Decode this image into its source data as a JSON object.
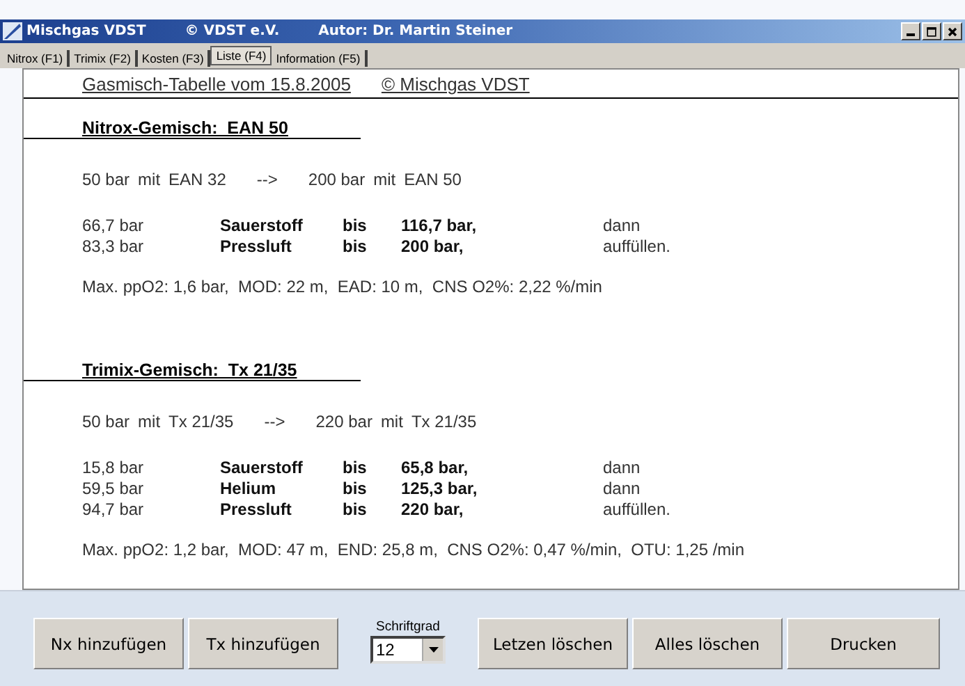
{
  "window": {
    "title_parts": [
      "Mischgas VDST",
      "© VDST e.V.",
      "Autor: Dr. Martin Steiner"
    ]
  },
  "tabs": [
    {
      "label": "Nitrox (F1)",
      "selected": false
    },
    {
      "label": "Trimix (F2)",
      "selected": false
    },
    {
      "label": "Kosten (F3)",
      "selected": false
    },
    {
      "label": "Liste (F4)",
      "selected": true
    },
    {
      "label": "Information (F5)",
      "selected": false
    }
  ],
  "document": {
    "header": [
      "Gasmisch-Tabelle vom 15.8.2005",
      "© Mischgas VDST"
    ],
    "sections": [
      {
        "heading": "Nitrox-Gemisch:  EAN 50",
        "summary": [
          "50 bar",
          "mit",
          "EAN 32",
          "-->",
          "200 bar",
          "mit",
          "EAN 50"
        ],
        "rows": [
          {
            "amount": "66,7 bar",
            "gas": "Sauerstoff",
            "bis": "bis",
            "target": "116,7 bar,",
            "action": "dann"
          },
          {
            "amount": "83,3 bar",
            "gas": "Pressluft",
            "bis": "bis",
            "target": "200 bar,",
            "action": "auffüllen."
          }
        ],
        "info": "Max. ppO2: 1,6 bar,  MOD: 22 m,  EAD: 10 m,  CNS O2%: 2,22 %/min"
      },
      {
        "heading": "Trimix-Gemisch:  Tx 21/35",
        "summary": [
          "50 bar",
          "mit",
          "Tx 21/35",
          "-->",
          "220 bar",
          "mit",
          "Tx 21/35"
        ],
        "rows": [
          {
            "amount": "15,8 bar",
            "gas": "Sauerstoff",
            "bis": "bis",
            "target": "65,8 bar,",
            "action": "dann"
          },
          {
            "amount": "59,5 bar",
            "gas": "Helium",
            "bis": "bis",
            "target": "125,3 bar,",
            "action": "dann"
          },
          {
            "amount": "94,7 bar",
            "gas": "Pressluft",
            "bis": "bis",
            "target": "220 bar,",
            "action": "auffüllen."
          }
        ],
        "info": "Max. ppO2: 1,2 bar,  MOD: 47 m,  END: 25,8 m,  CNS O2%: 0,47 %/min,  OTU: 1,25 /min"
      }
    ]
  },
  "toolbar": [
    {
      "kind": "button",
      "label": "Nx hinzufügen"
    },
    {
      "kind": "button",
      "label": "Tx hinzufügen"
    },
    {
      "kind": "select",
      "label": "Schriftgrad",
      "value": "12"
    },
    {
      "kind": "button",
      "label": "Letzen löschen"
    },
    {
      "kind": "button",
      "label": "Alles löschen"
    },
    {
      "kind": "button",
      "label": "Drucken"
    }
  ]
}
